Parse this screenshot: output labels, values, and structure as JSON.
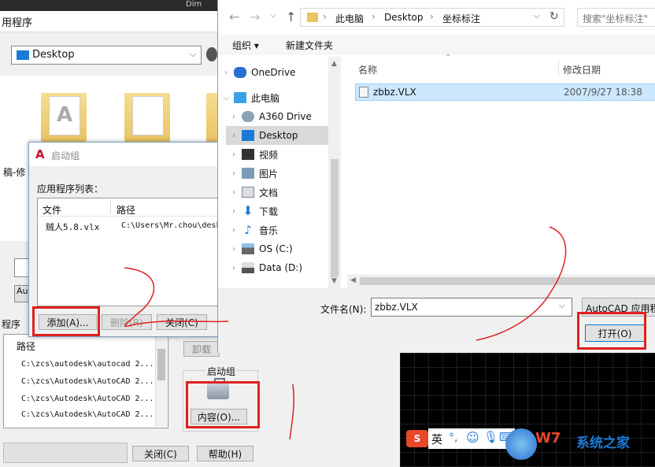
{
  "back_window": {
    "title": "加载应用程序",
    "title_partial": "用程序",
    "dim_partial": "Dim",
    "look_in_value": "Desktop",
    "folder_label_partial": "稿-修",
    "au_partial": "Au",
    "sequence_label": "程序",
    "path_header": "路径",
    "paths": [
      "C:\\zcs\\autodesk\\autocad 2...",
      "C:\\zcs\\Autodesk\\AutoCAD 2...",
      "C:\\zcs\\Autodesk\\AutoCAD 2...",
      "C:\\zcs\\Autodesk\\AutoCAD 2..."
    ],
    "unload_partial": "卸载",
    "startup_group_label": "启动组",
    "contents_button": "内容(O)...",
    "close_button": "关闭(C)",
    "help_button": "帮助(H)"
  },
  "startup_dialog": {
    "title": "启动组",
    "list_label": "应用程序列表：",
    "col_file": "文件",
    "col_path": "路径",
    "rows": [
      {
        "file": "贼人5.8.vlx",
        "path": "C:\\Users\\Mr.chou\\desk"
      }
    ],
    "add_button": "添加(A)...",
    "remove_button": "删除(R)",
    "close_button": "关闭(C)"
  },
  "file_dialog": {
    "breadcrumb": [
      "此电脑",
      "Desktop",
      "坐标标注"
    ],
    "search_placeholder": "搜索\"坐标标注\"",
    "organize_label": "组织 ▾",
    "new_folder_label": "新建文件夹",
    "nav_items": [
      {
        "label": "OneDrive",
        "icon": "cloud-icon"
      },
      {
        "label": "此电脑",
        "icon": "computer-icon"
      },
      {
        "label": "A360 Drive",
        "icon": "drive-icon"
      },
      {
        "label": "Desktop",
        "icon": "desktop-icon"
      },
      {
        "label": "视频",
        "icon": "video-icon"
      },
      {
        "label": "图片",
        "icon": "picture-icon"
      },
      {
        "label": "文档",
        "icon": "document-icon"
      },
      {
        "label": "下载",
        "icon": "download-icon"
      },
      {
        "label": "音乐",
        "icon": "music-icon"
      },
      {
        "label": "OS (C:)",
        "icon": "os-drive-icon"
      },
      {
        "label": "Data (D:)",
        "icon": "data-drive-icon"
      }
    ],
    "col_name": "名称",
    "col_modified": "修改日期",
    "files": [
      {
        "name": "zbbz.VLX",
        "modified": "2007/9/27 18:38"
      }
    ],
    "filename_label": "文件名(N):",
    "filename_value": "zbbz.VLX",
    "filetype_value": "AutoCAD 应用程",
    "open_button": "打开(O)"
  },
  "taskbar": {
    "ime_label": "英",
    "watermark": "系统之家"
  },
  "colors": {
    "highlight_red": "#e02020",
    "selection_blue": "#cce8ff",
    "folder_yellow": "#e9c463"
  }
}
